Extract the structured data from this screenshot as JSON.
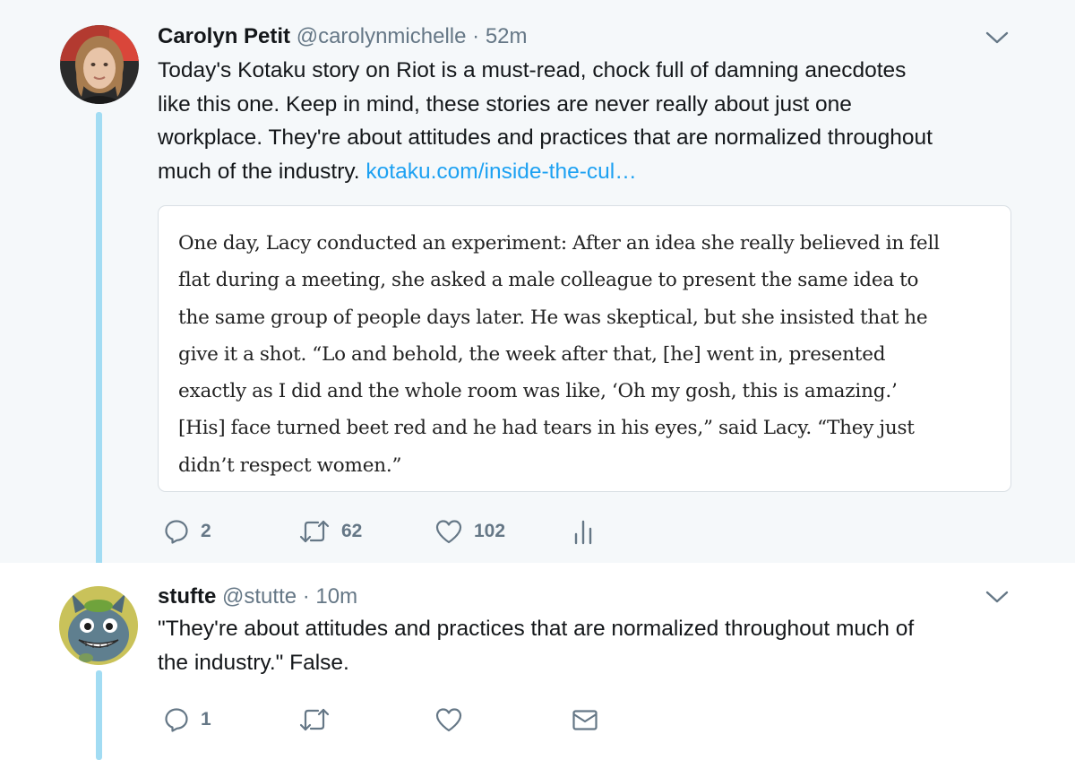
{
  "tweets": [
    {
      "name": "Carolyn Petit",
      "handle": "@carolynmichelle",
      "time": "52m",
      "text_lines": [
        "Today's Kotaku story on Riot is a must-read, chock full of damning anecdotes",
        "like this one. Keep in mind, these stories are never really about just one",
        "workplace. They're about attitudes and practices that are normalized throughout",
        "much of the industry."
      ],
      "link": "kotaku.com/inside-the-cul…",
      "quote_lines": [
        "One day, Lacy conducted an experiment: After an idea she really believed in fell",
        "flat during a meeting, she asked a male colleague to present the same idea to",
        "the same group of people days later. He was skeptical, but she insisted that he",
        "give it a shot. “Lo and behold, the week after that, [he] went in, presented",
        "exactly as I did and the whole room was like, ‘Oh my gosh, this is amazing.’",
        "[His] face turned beet red and he had tears in his eyes,” said Lacy. “They just",
        "didn’t respect women.”"
      ],
      "replies": "2",
      "retweets": "62",
      "likes": "102"
    },
    {
      "name": "stufte",
      "handle": "@stutte",
      "time": "10m",
      "text_lines": [
        "\"They're about attitudes and practices that are normalized throughout much of",
        "the industry.\" False."
      ],
      "replies": "1"
    }
  ],
  "separator": "·",
  "icons": {
    "caret": "chevron-down-icon",
    "reply": "reply-icon",
    "retweet": "retweet-icon",
    "like": "heart-icon",
    "analytics": "analytics-icon",
    "message": "envelope-icon"
  },
  "colors": {
    "link": "#1da1f2",
    "thread_line": "#a2dcf3",
    "muted": "#657786",
    "highlight_background": "#f5f8fa"
  }
}
